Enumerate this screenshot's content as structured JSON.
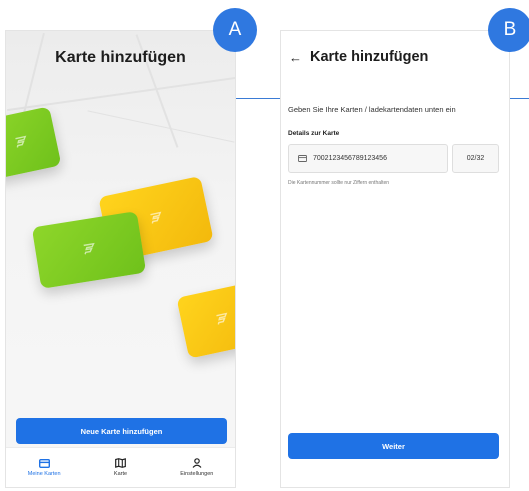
{
  "badges": {
    "a": "A",
    "b": "B"
  },
  "screen_a": {
    "title": "Karte hinzufügen",
    "button_label": "Neue Karte hinzufügen",
    "tabs": [
      {
        "label": "Meine Karten",
        "icon": "card-icon",
        "active": true
      },
      {
        "label": "Karte",
        "icon": "map-icon",
        "active": false
      },
      {
        "label": "Einstellungen",
        "icon": "user-icon",
        "active": false
      }
    ]
  },
  "screen_b": {
    "back_icon": "arrow-left-icon",
    "title": "Karte hinzufügen",
    "subtitle": "Geben Sie Ihre Karten / ladekartendaten unten ein",
    "section_label": "Details zur Karte",
    "card_number": "7002123456789123456",
    "expiry": "02/32",
    "hint": "Die Kartennummer sollte nur Ziffern enthalten",
    "button_label": "Weiter"
  },
  "colors": {
    "accent": "#1f72e5",
    "badge": "#2f78e0",
    "card_green": "#7cc920",
    "card_yellow": "#f8c612"
  }
}
